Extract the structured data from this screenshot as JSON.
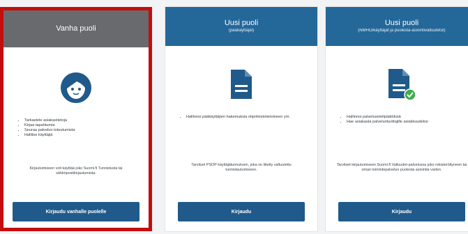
{
  "colors": {
    "header_old": "#696a6e",
    "header_new": "#24689a",
    "button": "#1f5a8a",
    "selection_border": "#c40d0d",
    "check_badge": "#3fae49"
  },
  "cards": [
    {
      "title": "Vanha puoli",
      "subtitle": "",
      "icon": "user-face-icon",
      "features": [
        "Tarkastele asiakastietoja",
        "Kirjaa tapahtumia",
        "Seuraa palvelun toteutumista",
        "Hallitse käyttäjiä"
      ],
      "description": "Kirjautumiseen voit käyttää joko Suomi.fi Tunnistusta tai sähköpostikirjautumista.",
      "button": "Kirjaudu vanhalle puolelle",
      "selected": true
    },
    {
      "title": "Uusi puoli",
      "subtitle": "(pääkäyttäjät)",
      "icon": "document-icon",
      "features": [
        "Hallinnoi pääkäyttäjien hakemuksia ohjelmistotietoineen ym."
      ],
      "description": "Tarvitset PSOP käyttäjätunnuksen, joka on liitetty valtuutettu tunnistautumiseen.",
      "button": "Kirjaudu",
      "selected": false
    },
    {
      "title": "Uusi puoli",
      "subtitle": "(NMHO/käyttäjät ja puolesta-asiointivaltuutetut)",
      "icon": "document-check-icon",
      "features": [
        "Hallinnoi palvelusetelipäätöksiä",
        "Hae asiakasta palveluntuottajille asiakkuudeksi"
      ],
      "description": "Tarvitset kirjautumiseen Suomi.fi Valtuudet-palvelussa joko rekisteröityneen tai oman toimintopalvelun puolesta asiointia varten.",
      "button": "Kirjaudu",
      "selected": false
    }
  ]
}
